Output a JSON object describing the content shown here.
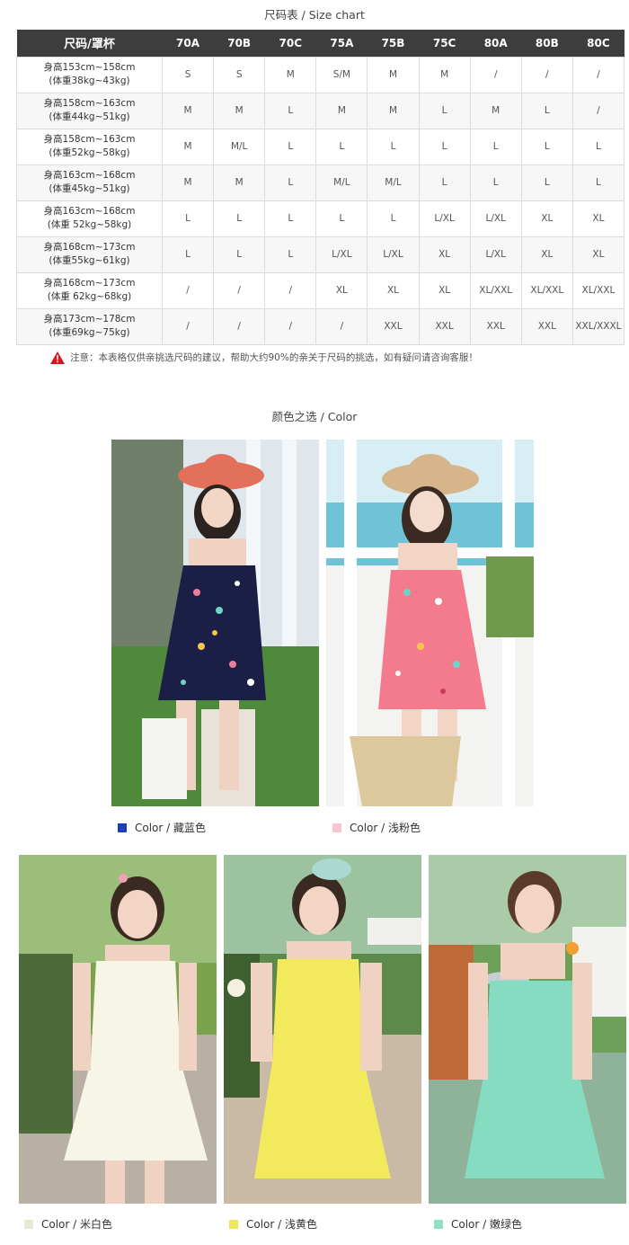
{
  "size_chart": {
    "title": "尺码表 / Size chart",
    "header_first": "尺码/罩杯",
    "columns": [
      "70A",
      "70B",
      "70C",
      "75A",
      "75B",
      "75C",
      "80A",
      "80B",
      "80C"
    ],
    "rows": [
      {
        "label1": "身高153cm~158cm",
        "label2": "(体重38kg~43kg)",
        "cells": [
          "S",
          "S",
          "M",
          "S/M",
          "M",
          "M",
          "/",
          "/",
          "/"
        ]
      },
      {
        "label1": "身高158cm~163cm",
        "label2": "(体重44kg~51kg)",
        "cells": [
          "M",
          "M",
          "L",
          "M",
          "M",
          "L",
          "M",
          "L",
          "/"
        ]
      },
      {
        "label1": "身高158cm~163cm",
        "label2": "(体重52kg~58kg)",
        "cells": [
          "M",
          "M/L",
          "L",
          "L",
          "L",
          "L",
          "L",
          "L",
          "L"
        ]
      },
      {
        "label1": "身高163cm~168cm",
        "label2": "(体重45kg~51kg)",
        "cells": [
          "M",
          "M",
          "L",
          "M/L",
          "M/L",
          "L",
          "L",
          "L",
          "L"
        ]
      },
      {
        "label1": "身高163cm~168cm",
        "label2": "(体重 52kg~58kg)",
        "cells": [
          "L",
          "L",
          "L",
          "L",
          "L",
          "L/XL",
          "L/XL",
          "XL",
          "XL"
        ]
      },
      {
        "label1": "身高168cm~173cm",
        "label2": "(体重55kg~61kg)",
        "cells": [
          "L",
          "L",
          "L",
          "L/XL",
          "L/XL",
          "XL",
          "L/XL",
          "XL",
          "XL"
        ]
      },
      {
        "label1": "身高168cm~173cm",
        "label2": "(体重 62kg~68kg)",
        "cells": [
          "/",
          "/",
          "/",
          "XL",
          "XL",
          "XL",
          "XL/XXL",
          "XL/XXL",
          "XL/XXL"
        ]
      },
      {
        "label1": "身高173cm~178cm",
        "label2": "(体重69kg~75kg)",
        "cells": [
          "/",
          "/",
          "/",
          "/",
          "XXL",
          "XXL",
          "XXL",
          "XXL",
          "XXL/XXXL"
        ]
      }
    ],
    "note": "注意：本表格仅供亲挑选尺码的建议，帮助大约90%的亲关于尺码的挑选，如有疑问请咨询客服！",
    "note_icon": "warning-icon"
  },
  "colors": {
    "title": "颜色之选 / Color",
    "items": [
      {
        "label": "Color / 藏蓝色",
        "swatch": "#1a3fb8",
        "dress": "#1b1e45"
      },
      {
        "label": "Color / 浅粉色",
        "swatch": "#f7c4d2",
        "dress": "#f47b8e"
      },
      {
        "label": "Color / 米白色",
        "swatch": "#e6e7d4",
        "dress": "#f7f5e6"
      },
      {
        "label": "Color / 浅黄色",
        "swatch": "#f0e65a",
        "dress": "#f2ea5c"
      },
      {
        "label": "Color / 嫩绿色",
        "swatch": "#8fe0c2",
        "dress": "#86dcc0"
      }
    ]
  }
}
